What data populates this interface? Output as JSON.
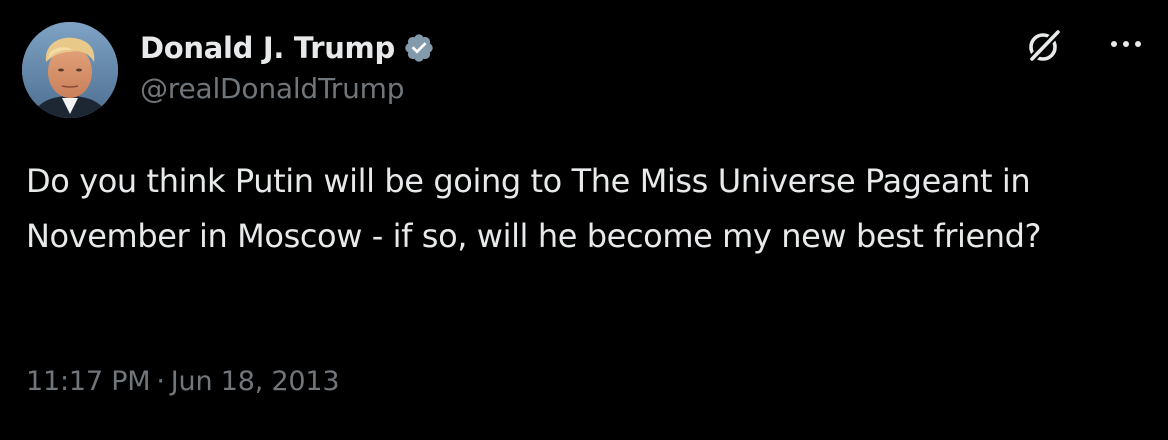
{
  "tweet": {
    "author": {
      "display_name": "Donald J. Trump",
      "handle": "@realDonaldTrump",
      "verified": true,
      "avatar_icon": "profile-photo"
    },
    "text": "Do you think Putin will be going to The Miss Universe Pageant in November in Moscow - if so, will he become my new best friend?",
    "time": "11:17 PM",
    "separator": "·",
    "date": "Jun 18, 2013"
  },
  "icons": {
    "verified": "verified-badge-icon",
    "grok": "grok-icon",
    "more": "more-options-icon"
  },
  "colors": {
    "background": "#000000",
    "primary_text": "#e7e9ea",
    "secondary_text": "#71767b",
    "verified_badge": "#829aab"
  }
}
